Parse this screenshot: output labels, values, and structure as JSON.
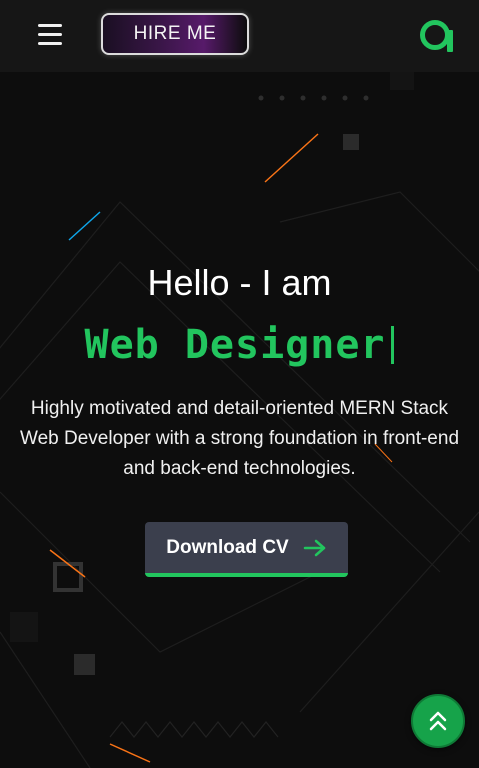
{
  "header": {
    "menu_icon": "hamburger-icon",
    "hire_label": "HIRE ME",
    "logo_icon": "brand-logo-icon"
  },
  "hero": {
    "greeting": "Hello - I am",
    "role": "Web Designer",
    "description": "Highly motivated and detail-oriented MERN Stack Web Developer with a strong foundation in front-end and back-end technologies.",
    "cta_label": "Download CV",
    "cta_icon": "arrow-right-icon"
  },
  "scroll_top": {
    "icon": "double-chevron-up-icon"
  },
  "colors": {
    "accent": "#22c55e",
    "background": "#0d0d0d",
    "header": "#161616",
    "button": "#3b3f4d"
  }
}
